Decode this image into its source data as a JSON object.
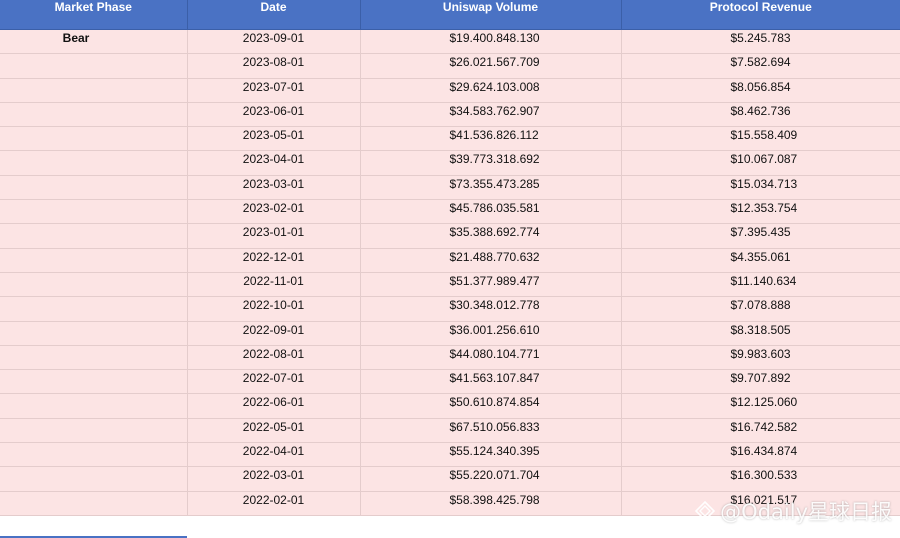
{
  "table": {
    "headers": [
      "Market Phase",
      "Date",
      "Uniswap Volume",
      "Protocol Revenue"
    ],
    "rows": [
      {
        "phase": "Bear",
        "date": "2023-09-01",
        "volume": "$19.400.848.130",
        "revenue": "$5.245.783"
      },
      {
        "phase": "",
        "date": "2023-08-01",
        "volume": "$26.021.567.709",
        "revenue": "$7.582.694"
      },
      {
        "phase": "",
        "date": "2023-07-01",
        "volume": "$29.624.103.008",
        "revenue": "$8.056.854"
      },
      {
        "phase": "",
        "date": "2023-06-01",
        "volume": "$34.583.762.907",
        "revenue": "$8.462.736"
      },
      {
        "phase": "",
        "date": "2023-05-01",
        "volume": "$41.536.826.112",
        "revenue": "$15.558.409"
      },
      {
        "phase": "",
        "date": "2023-04-01",
        "volume": "$39.773.318.692",
        "revenue": "$10.067.087"
      },
      {
        "phase": "",
        "date": "2023-03-01",
        "volume": "$73.355.473.285",
        "revenue": "$15.034.713"
      },
      {
        "phase": "",
        "date": "2023-02-01",
        "volume": "$45.786.035.581",
        "revenue": "$12.353.754"
      },
      {
        "phase": "",
        "date": "2023-01-01",
        "volume": "$35.388.692.774",
        "revenue": "$7.395.435"
      },
      {
        "phase": "",
        "date": "2022-12-01",
        "volume": "$21.488.770.632",
        "revenue": "$4.355.061"
      },
      {
        "phase": "",
        "date": "2022-11-01",
        "volume": "$51.377.989.477",
        "revenue": "$11.140.634"
      },
      {
        "phase": "",
        "date": "2022-10-01",
        "volume": "$30.348.012.778",
        "revenue": "$7.078.888"
      },
      {
        "phase": "",
        "date": "2022-09-01",
        "volume": "$36.001.256.610",
        "revenue": "$8.318.505"
      },
      {
        "phase": "",
        "date": "2022-08-01",
        "volume": "$44.080.104.771",
        "revenue": "$9.983.603"
      },
      {
        "phase": "",
        "date": "2022-07-01",
        "volume": "$41.563.107.847",
        "revenue": "$9.707.892"
      },
      {
        "phase": "",
        "date": "2022-06-01",
        "volume": "$50.610.874.854",
        "revenue": "$12.125.060"
      },
      {
        "phase": "",
        "date": "2022-05-01",
        "volume": "$67.510.056.833",
        "revenue": "$16.742.582"
      },
      {
        "phase": "",
        "date": "2022-04-01",
        "volume": "$55.124.340.395",
        "revenue": "$16.434.874"
      },
      {
        "phase": "",
        "date": "2022-03-01",
        "volume": "$55.220.071.704",
        "revenue": "$16.300.533"
      },
      {
        "phase": "",
        "date": "2022-02-01",
        "volume": "$58.398.425.798",
        "revenue": "$16.021.517"
      }
    ]
  },
  "watermark": {
    "text": "@Odaily星球日报",
    "icon": "odaily-logo-icon"
  },
  "colors": {
    "header_bg": "#4a72c4",
    "row_bg": "#fce4e4"
  }
}
